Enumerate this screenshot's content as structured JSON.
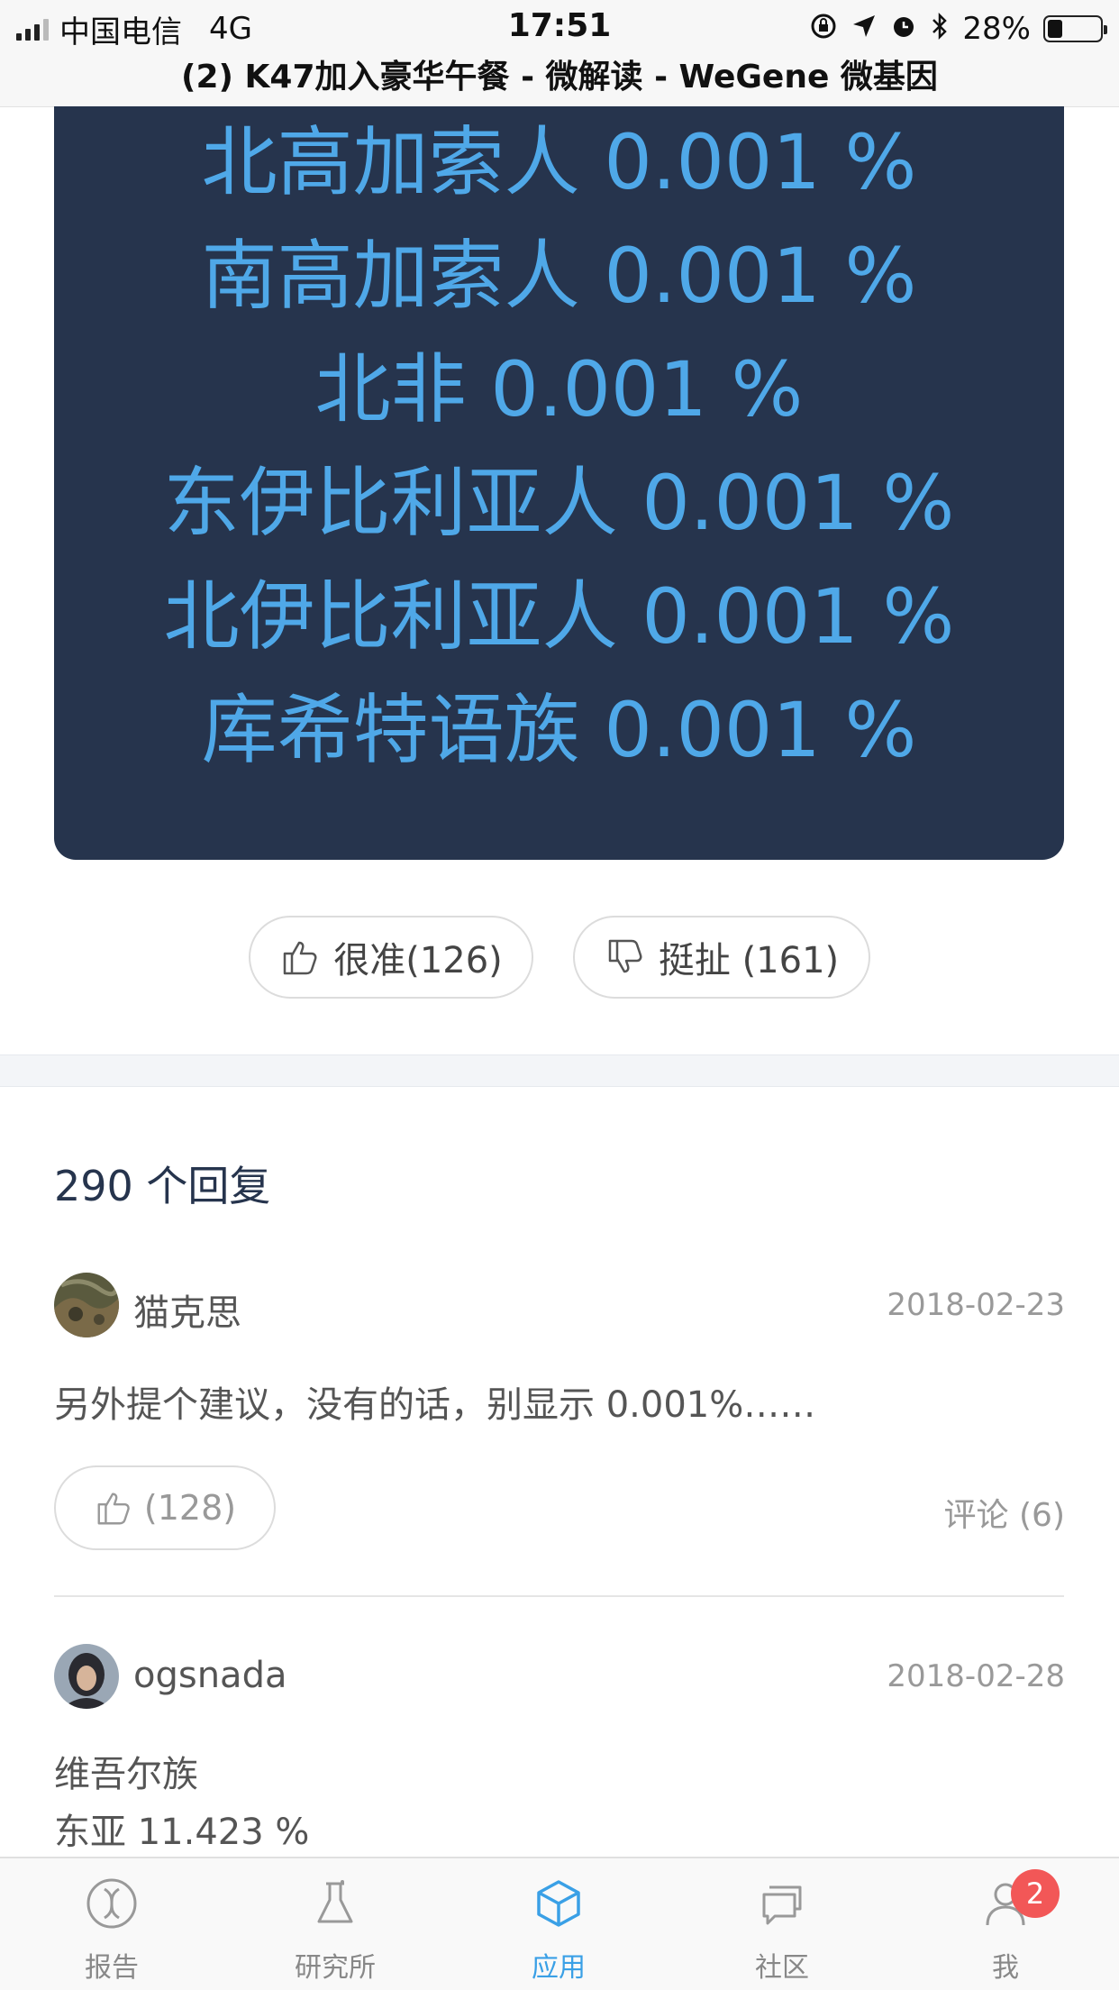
{
  "status_bar": {
    "carrier": "中国电信",
    "network": "4G",
    "time": "17:51",
    "battery": "28%",
    "battery_level": 0.28
  },
  "page_title": "(2) K47加入豪华午餐 - 微解读 - WeGene 微基因",
  "ancestry_results": [
    "北高加索人 0.001 %",
    "南高加索人 0.001 %",
    "北非 0.001 %",
    "东伊比利亚人 0.001 %",
    "北伊比利亚人 0.001 %",
    "库希特语族 0.001 %"
  ],
  "votes": {
    "accurate_label": "很准(126)",
    "inaccurate_label": "挺扯 (161)"
  },
  "reply_count": "290 个回复",
  "comments": [
    {
      "username": "猫克思",
      "date": "2018-02-23",
      "text": "另外提个建议，没有的话，别显示 0.001%……",
      "likes": "(128)",
      "comments_link": "评论 (6)"
    },
    {
      "username": "ogsnada",
      "date": "2018-02-28",
      "text_line1": "维吾尔族",
      "text_line2": "东亚 11.423 %"
    }
  ],
  "tabbar": {
    "items": [
      {
        "label": "报告",
        "icon": "dna-icon"
      },
      {
        "label": "研究所",
        "icon": "flask-icon"
      },
      {
        "label": "应用",
        "icon": "cube-icon"
      },
      {
        "label": "社区",
        "icon": "chat-icon"
      },
      {
        "label": "我",
        "icon": "user-icon"
      }
    ],
    "active": "应用",
    "badge": "2"
  },
  "colors": {
    "card_bg": "#26344d",
    "result_text": "#4fa8e8",
    "accent": "#3aa0e6",
    "badge": "#f25757"
  }
}
